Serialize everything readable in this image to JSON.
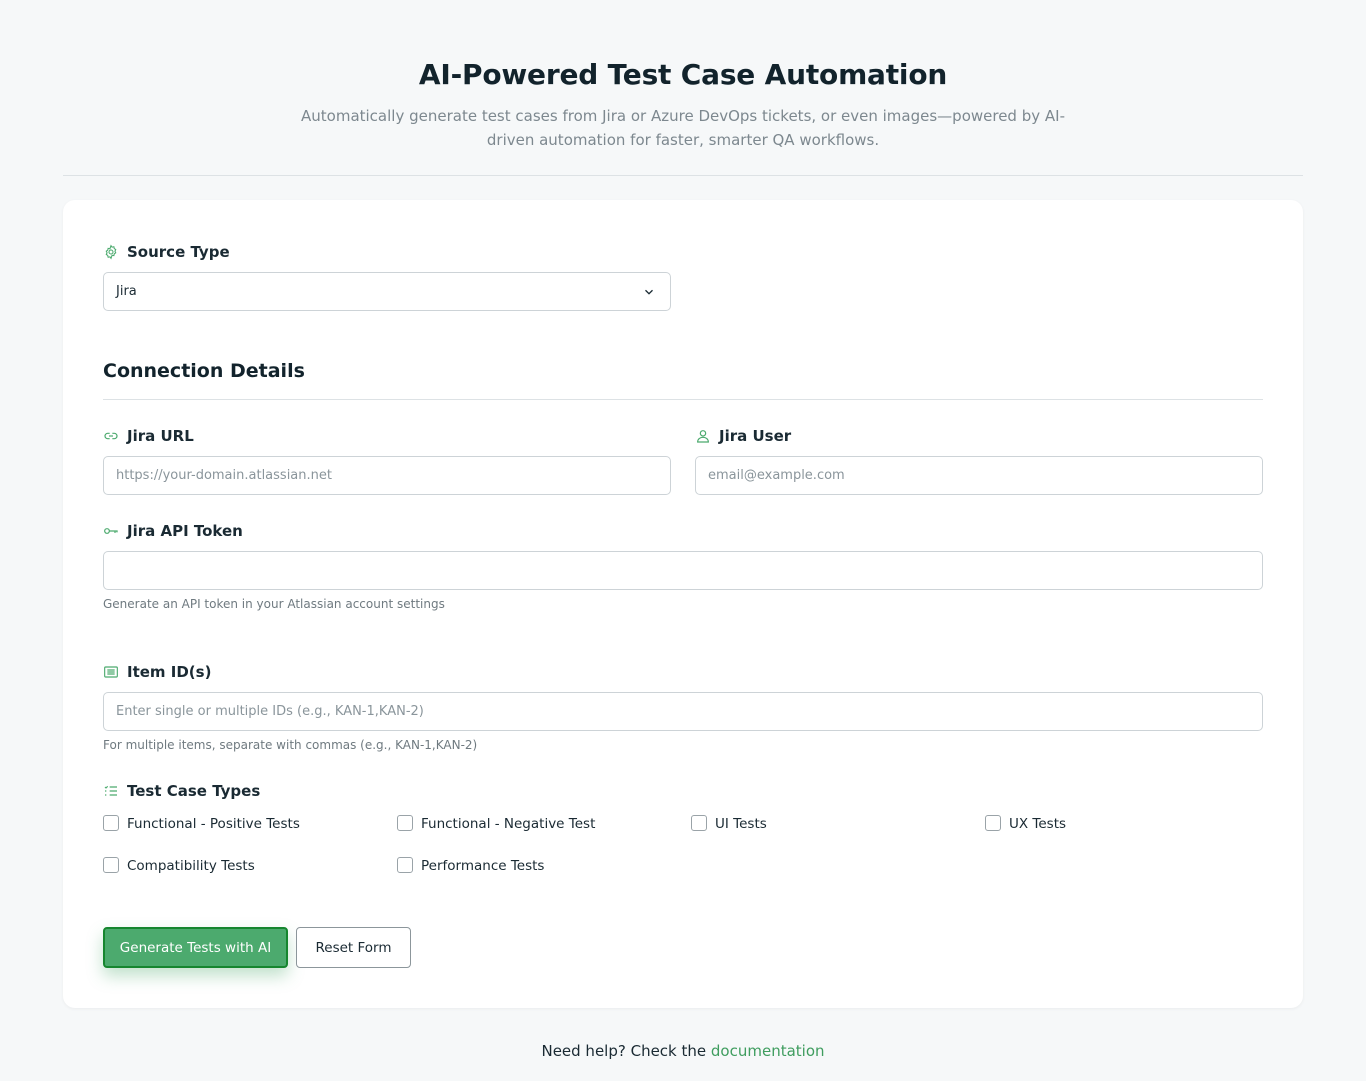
{
  "header": {
    "title": "AI-Powered Test Case Automation",
    "subtitle": "Automatically generate test cases from Jira or Azure DevOps tickets, or even images—powered by AI-driven automation for faster, smarter QA workflows."
  },
  "source_type": {
    "label": "Source Type",
    "selected": "Jira",
    "icon": "gear-icon"
  },
  "connection": {
    "title": "Connection Details",
    "jira_url": {
      "label": "Jira URL",
      "placeholder": "https://your-domain.atlassian.net",
      "value": "",
      "icon": "link-icon"
    },
    "jira_user": {
      "label": "Jira User",
      "placeholder": "email@example.com",
      "value": "",
      "icon": "user-icon"
    },
    "api_token": {
      "label": "Jira API Token",
      "value": "",
      "hint": "Generate an API token in your Atlassian account settings",
      "icon": "key-icon"
    }
  },
  "item_ids": {
    "label": "Item ID(s)",
    "placeholder": "Enter single or multiple IDs (e.g., KAN-1,KAN-2)",
    "value": "",
    "hint": "For multiple items, separate with commas (e.g., KAN-1,KAN-2)",
    "icon": "list-box-icon"
  },
  "test_types": {
    "label": "Test Case Types",
    "icon": "checklist-icon",
    "options": [
      {
        "label": "Functional - Positive Tests",
        "checked": false
      },
      {
        "label": "Functional - Negative Test",
        "checked": false
      },
      {
        "label": "UI Tests",
        "checked": false
      },
      {
        "label": "UX Tests",
        "checked": false
      },
      {
        "label": "Compatibility Tests",
        "checked": false
      },
      {
        "label": "Performance Tests",
        "checked": false
      }
    ]
  },
  "actions": {
    "generate_label": "Generate Tests with AI",
    "reset_label": "Reset Form"
  },
  "footer": {
    "text": "Need help? Check the",
    "link": "documentation"
  },
  "colors": {
    "accent": "#4caa6e",
    "accent_border": "#16862f",
    "link": "#3f9d5f",
    "background": "#f6f8f9"
  }
}
